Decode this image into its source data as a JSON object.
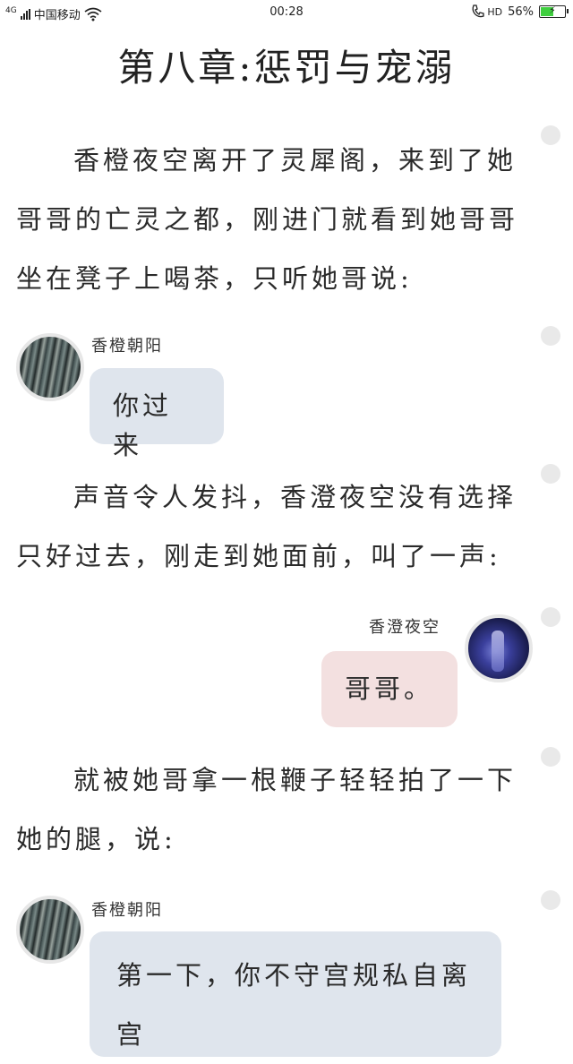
{
  "status_bar": {
    "network": "4G",
    "carrier": "中国移动",
    "time": "00:28",
    "hd_label": "HD",
    "battery_percent": "56%",
    "battery_level": 0.56,
    "icons": [
      "signal-icon",
      "wifi-icon",
      "call-icon",
      "battery-icon"
    ]
  },
  "chapter": {
    "title": "第八章:惩罚与宠溺"
  },
  "story": {
    "para1": "香橙夜空离开了灵犀阁，来到了她哥哥的亡灵之都，刚进门就看到她哥哥坐在凳子上喝茶，只听她哥说:",
    "msg1": {
      "speaker": "香橙朝阳",
      "text": "你过来"
    },
    "para2": "声音令人发抖，香澄夜空没有选择只好过去，刚走到她面前，叫了一声:",
    "msg2": {
      "speaker": "香澄夜空",
      "text": "哥哥。"
    },
    "para3": "就被她哥拿一根鞭子轻轻拍了一下她的腿，说:",
    "msg3": {
      "speaker": "香橙朝阳",
      "text": "第一下，你不守宫规私自离宫"
    }
  },
  "colors": {
    "bubble_left": "#dfe5ed",
    "bubble_right": "#f3e0e0",
    "comment_dot": "#e9e9e9"
  }
}
